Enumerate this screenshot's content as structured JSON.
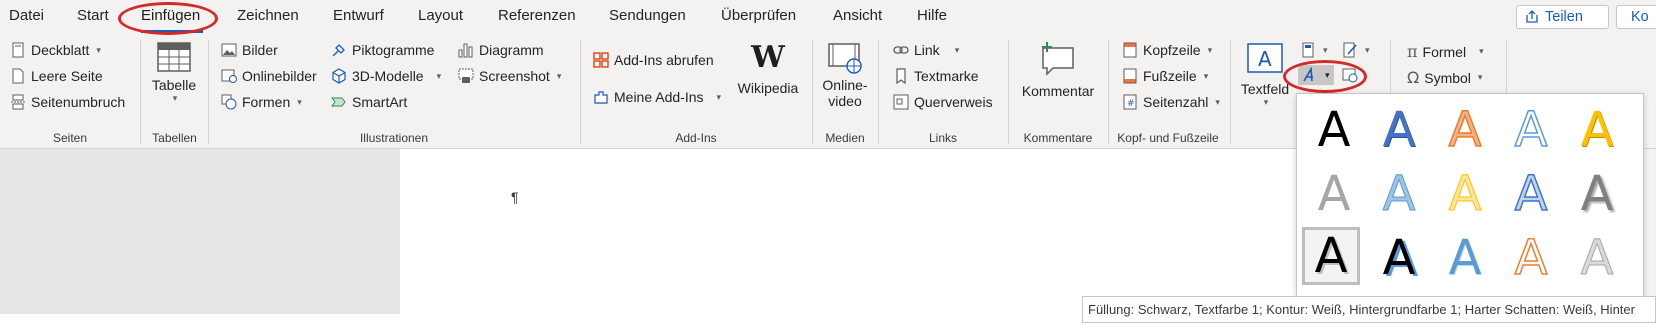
{
  "tabs": [
    "Datei",
    "Start",
    "Einfügen",
    "Zeichnen",
    "Entwurf",
    "Layout",
    "Referenzen",
    "Sendungen",
    "Überprüfen",
    "Ansicht",
    "Hilfe"
  ],
  "active_tab": "Einfügen",
  "top_buttons": {
    "share": "Teilen",
    "comments": "Ko"
  },
  "groups": {
    "seiten": {
      "label": "Seiten",
      "items": [
        "Deckblatt",
        "Leere Seite",
        "Seitenumbruch"
      ]
    },
    "tabellen": {
      "label": "Tabellen",
      "table": "Tabelle"
    },
    "illustrationen": {
      "label": "Illustrationen",
      "col1": [
        "Bilder",
        "Onlinebilder",
        "Formen"
      ],
      "col2": [
        "Piktogramme",
        "3D-Modelle",
        "SmartArt"
      ],
      "col3": [
        "Diagramm",
        "Screenshot"
      ]
    },
    "addins": {
      "label": "Add-Ins",
      "get": "Add-Ins abrufen",
      "mine": "Meine Add-Ins",
      "wikipedia": "Wikipedia"
    },
    "medien": {
      "label": "Medien",
      "video_line1": "Online-",
      "video_line2": "video"
    },
    "links": {
      "label": "Links",
      "items": [
        "Link",
        "Textmarke",
        "Querverweis"
      ]
    },
    "kommentare": {
      "label": "Kommentare",
      "comment": "Kommentar"
    },
    "kopf": {
      "label": "Kopf- und Fußzeile",
      "items": [
        "Kopfzeile",
        "Fußzeile",
        "Seitenzahl"
      ]
    },
    "text": {
      "textfeld": "Textfeld"
    },
    "symbole": {
      "items": [
        "Formel",
        "Symbol"
      ]
    }
  },
  "document": {
    "pilcrow": "¶"
  },
  "tooltip": "Füllung: Schwarz, Textfarbe 1; Kontur: Weiß, Hintergrundfarbe 1; Harter Schatten: Weiß, Hinter",
  "wordart_letter": "A",
  "colors": {
    "accent": "#185abd",
    "highlight": "#d42a2a"
  }
}
